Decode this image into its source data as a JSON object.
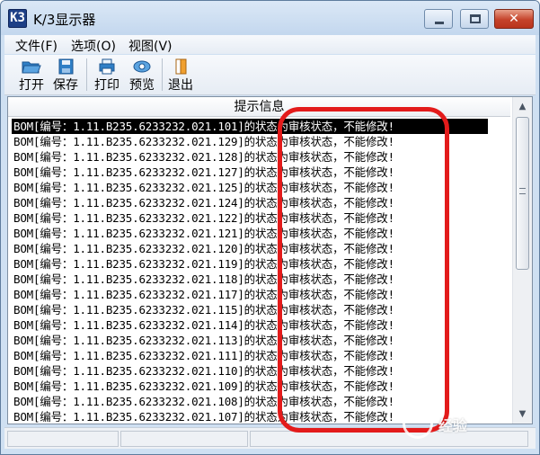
{
  "window": {
    "title": "K/3显示器",
    "app_icon_glyph": "K3",
    "close_glyph": "✕"
  },
  "menu": {
    "items": [
      {
        "label": "文件(F)"
      },
      {
        "label": "选项(O)"
      },
      {
        "label": "视图(V)"
      }
    ]
  },
  "toolbar": {
    "open_label": "打开",
    "save_label": "保存",
    "print_label": "打印",
    "preview_label": "预览",
    "exit_label": "退出"
  },
  "list": {
    "header": "提示信息",
    "rows": [
      "BOM[编号：1.11.B235.6233232.021.101]的状态为审核状态，不能修改!",
      "BOM[编号：1.11.B235.6233232.021.129]的状态为审核状态，不能修改!",
      "BOM[编号：1.11.B235.6233232.021.128]的状态为审核状态，不能修改!",
      "BOM[编号：1.11.B235.6233232.021.127]的状态为审核状态，不能修改!",
      "BOM[编号：1.11.B235.6233232.021.125]的状态为审核状态，不能修改!",
      "BOM[编号：1.11.B235.6233232.021.124]的状态为审核状态，不能修改!",
      "BOM[编号：1.11.B235.6233232.021.122]的状态为审核状态，不能修改!",
      "BOM[编号：1.11.B235.6233232.021.121]的状态为审核状态，不能修改!",
      "BOM[编号：1.11.B235.6233232.021.120]的状态为审核状态，不能修改!",
      "BOM[编号：1.11.B235.6233232.021.119]的状态为审核状态，不能修改!",
      "BOM[编号：1.11.B235.6233232.021.118]的状态为审核状态，不能修改!",
      "BOM[编号：1.11.B235.6233232.021.117]的状态为审核状态，不能修改!",
      "BOM[编号：1.11.B235.6233232.021.115]的状态为审核状态，不能修改!",
      "BOM[编号：1.11.B235.6233232.021.114]的状态为审核状态，不能修改!",
      "BOM[编号：1.11.B235.6233232.021.113]的状态为审核状态，不能修改!",
      "BOM[编号：1.11.B235.6233232.021.111]的状态为审核状态，不能修改!",
      "BOM[编号：1.11.B235.6233232.021.110]的状态为审核状态，不能修改!",
      "BOM[编号：1.11.B235.6233232.021.109]的状态为审核状态，不能修改!",
      "BOM[编号：1.11.B235.6233232.021.108]的状态为审核状态，不能修改!",
      "BOM[编号：1.11.B235.6233232.021.107]的状态为审核状态，不能修改!"
    ]
  },
  "scrollbar": {
    "up_glyph": "▲",
    "down_glyph": "▼"
  },
  "watermark": {
    "text": "经验"
  },
  "colors": {
    "highlight": "#e31b1b",
    "selection": "#000000"
  },
  "icons": {
    "open": "folder-open-icon",
    "save": "floppy-disk-icon",
    "print": "printer-icon",
    "preview": "eye-preview-icon",
    "exit": "exit-door-icon"
  }
}
